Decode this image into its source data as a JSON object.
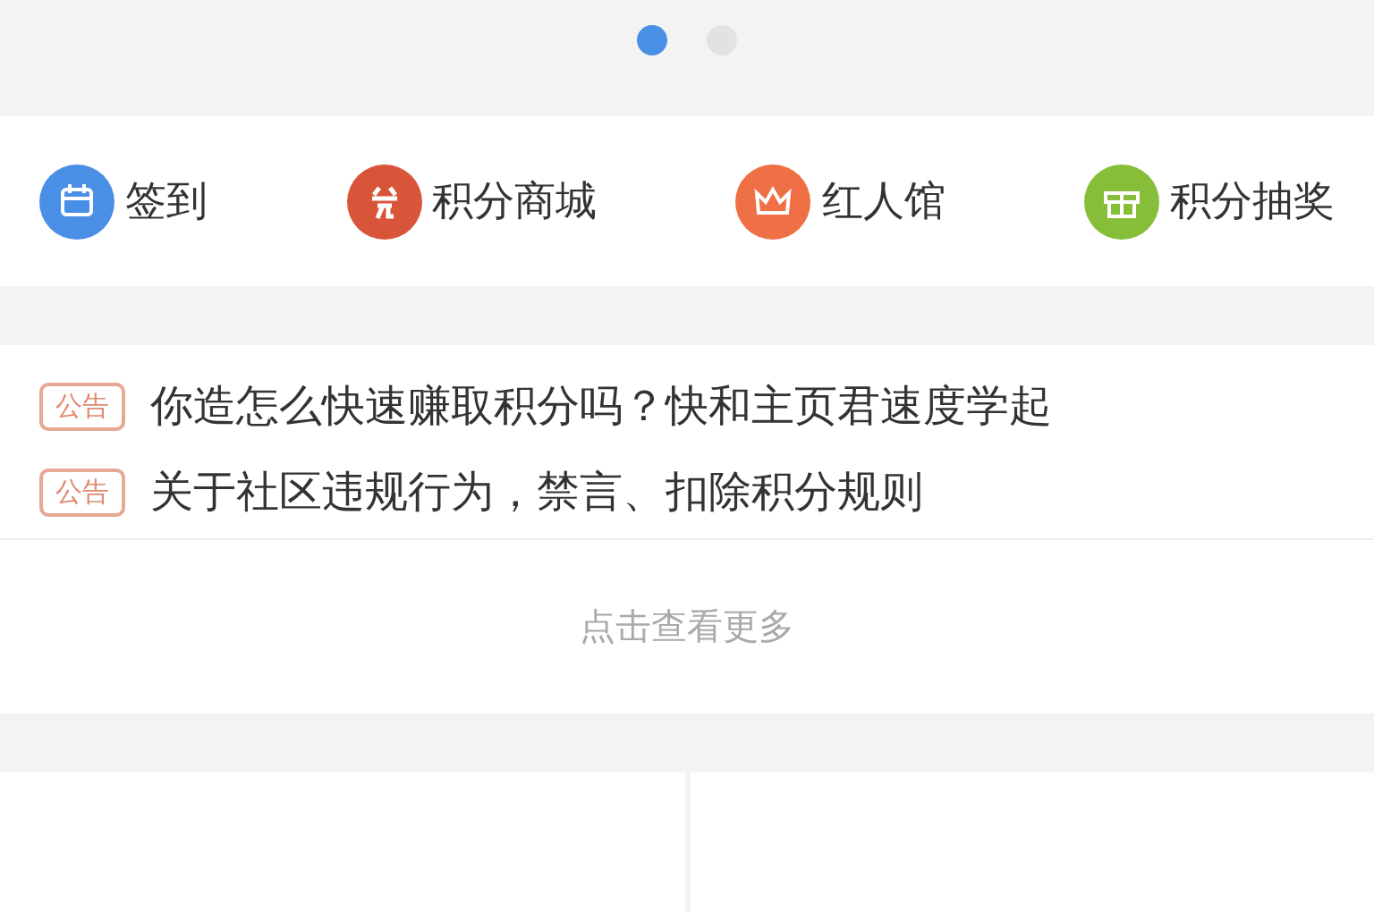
{
  "carousel_dots": [
    {
      "selected": true
    },
    {
      "selected": false
    }
  ],
  "shortcuts": [
    {
      "label": "签到",
      "kind": "calendar",
      "color": "#4a8fe6"
    },
    {
      "label": "积分商城",
      "kind": "exchange",
      "color": "#d9553a"
    },
    {
      "label": "红人馆",
      "kind": "crown",
      "color": "#f07045"
    },
    {
      "label": "积分抽奖",
      "kind": "gift",
      "color": "#86be3a"
    }
  ],
  "notices": [
    {
      "tag": "公告",
      "text": "你造怎么快速赚取积分吗？快和主页君速度学起"
    },
    {
      "tag": "公告",
      "text": "关于社区违规行为，禁言、扣除积分规则"
    }
  ],
  "more_link": "点击查看更多",
  "bottom_tabs": [
    {
      "kind": "tab"
    },
    {
      "kind": "tab"
    }
  ]
}
